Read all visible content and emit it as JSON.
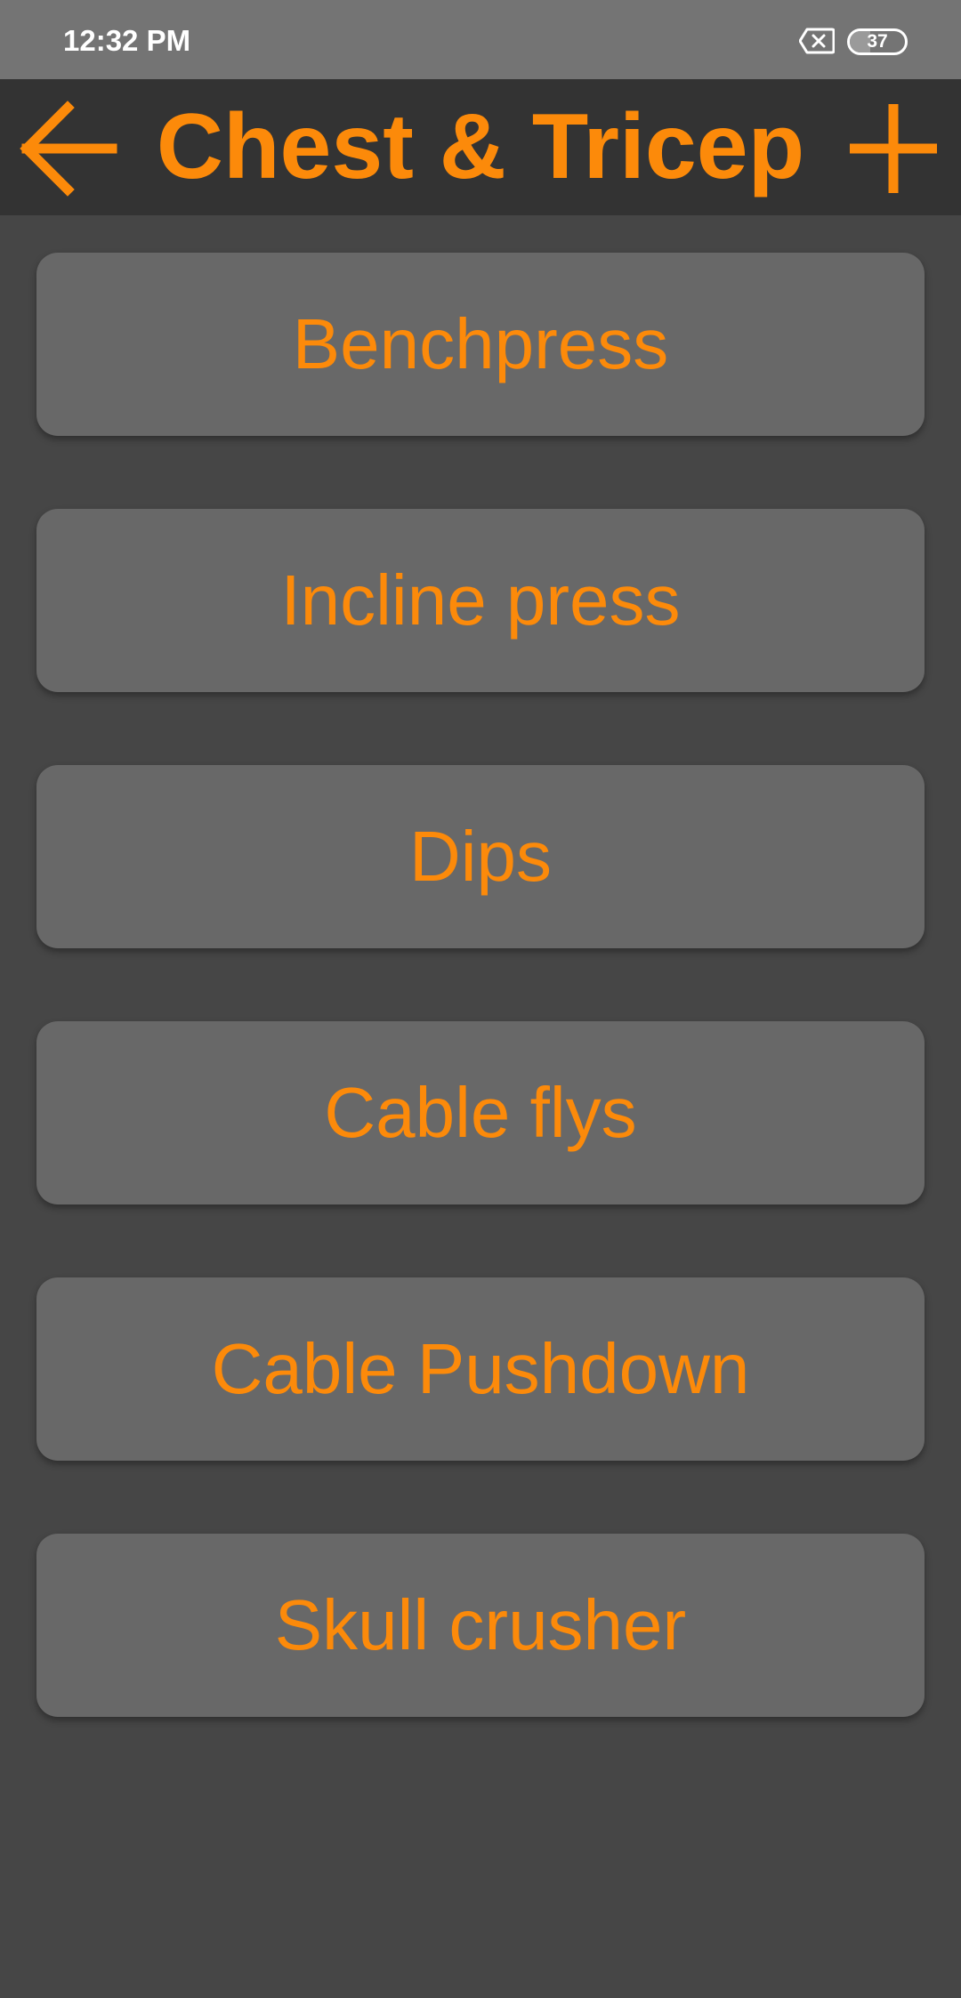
{
  "status_bar": {
    "time": "12:32 PM",
    "notification_icon": "close-box-icon",
    "battery_level": "37",
    "battery_fraction": 0.37
  },
  "header": {
    "title": "Chest & Tricep",
    "back_icon": "arrow-left-icon",
    "add_icon": "plus-icon"
  },
  "exercises": [
    {
      "label": "Benchpress"
    },
    {
      "label": "Incline press"
    },
    {
      "label": "Dips"
    },
    {
      "label": "Cable flys"
    },
    {
      "label": "Cable Pushdown"
    },
    {
      "label": "Skull crusher"
    }
  ],
  "colors": {
    "accent": "#fc8a0a",
    "background": "#464646",
    "header_bg": "#333333",
    "status_bar_bg": "#747474",
    "button_bg": "#686868"
  }
}
